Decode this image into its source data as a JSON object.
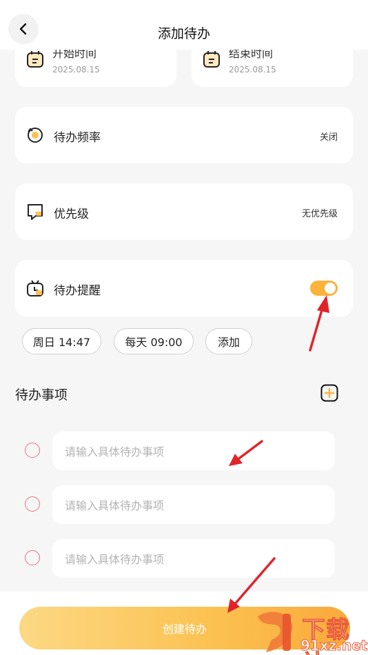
{
  "header": {
    "title": "添加待办"
  },
  "dates": {
    "start": {
      "label": "开始时间",
      "value": "2025.08.15"
    },
    "end": {
      "label": "结束时间",
      "value": "2025.08.15"
    }
  },
  "frequency": {
    "label": "待办频率",
    "value": "关闭"
  },
  "priority": {
    "label": "优先级",
    "value": "无优先级"
  },
  "reminder": {
    "label": "待办提醒",
    "enabled": true
  },
  "reminder_chips": [
    "周日 14:47",
    "每天 09:00",
    "添加"
  ],
  "todo_section": {
    "title": "待办事项",
    "placeholders": [
      "请输入具体待办事项",
      "请输入具体待办事项",
      "请输入具体待办事项"
    ]
  },
  "create_button": {
    "label": "创建待办"
  },
  "watermark": {
    "line1": "下载站",
    "line2": "91xz.net"
  },
  "colors": {
    "accent": "#fbb33a",
    "radio": "#ee6f86",
    "arrow": "#e0242a"
  }
}
